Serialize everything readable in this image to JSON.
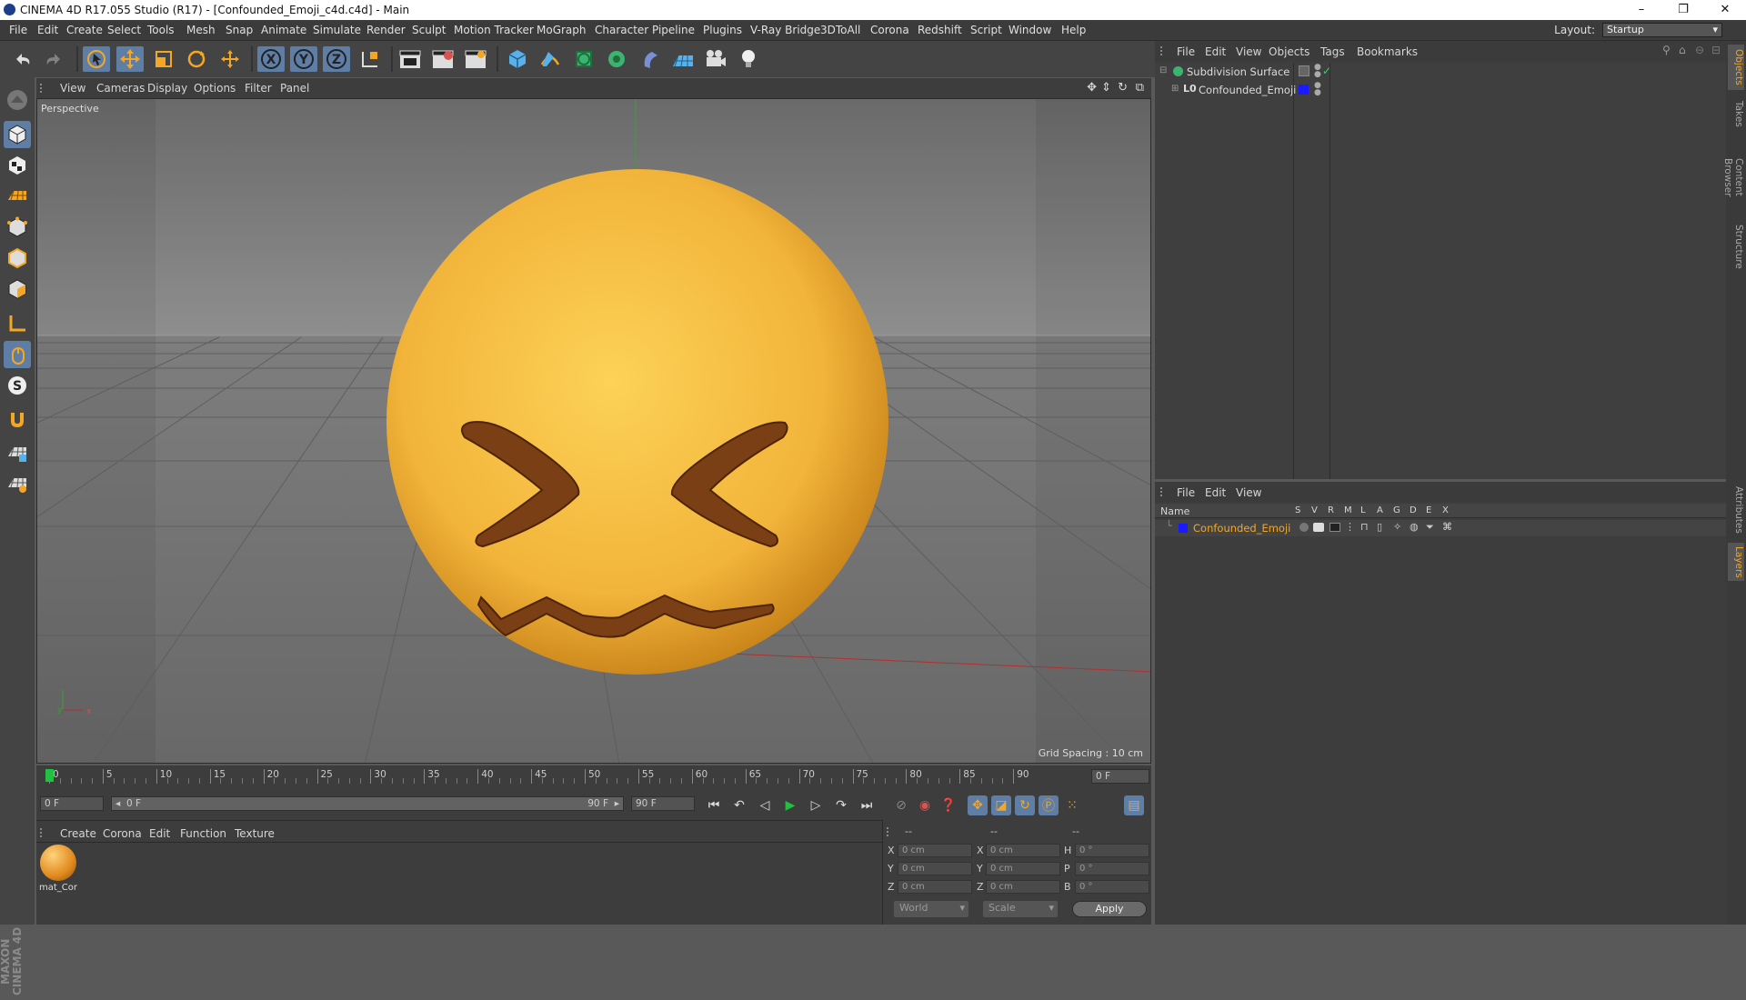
{
  "window": {
    "title": "CINEMA 4D R17.055 Studio (R17) - [Confounded_Emoji_c4d.c4d] - Main",
    "controls": [
      "–",
      "❐",
      "✕"
    ]
  },
  "menubar": {
    "items": [
      "File",
      "Edit",
      "Create",
      "Select",
      "Tools",
      "Mesh",
      "Snap",
      "Animate",
      "Simulate",
      "Render",
      "Sculpt",
      "Motion Tracker",
      "MoGraph",
      "Character",
      "Pipeline",
      "Plugins",
      "V-Ray Bridge",
      "3DToAll",
      "Corona",
      "Redshift",
      "Script",
      "Window",
      "Help"
    ],
    "layout_label": "Layout:",
    "layout_value": "Startup"
  },
  "viewport": {
    "menu": [
      "View",
      "Cameras",
      "Display",
      "Options",
      "Filter",
      "Panel"
    ],
    "label": "Perspective",
    "grid_spacing": "Grid Spacing : 10 cm",
    "axis_y": "y",
    "axis_x": "x"
  },
  "timeline": {
    "ticks": [
      "0",
      "5",
      "10",
      "15",
      "20",
      "25",
      "30",
      "35",
      "40",
      "45",
      "50",
      "55",
      "60",
      "65",
      "70",
      "75",
      "80",
      "85",
      "90"
    ],
    "current_frame": "0 F",
    "start_field": "0 F",
    "range_start": "0 F",
    "range_end": "90 F",
    "end_field": "90 F"
  },
  "materials": {
    "menu": [
      "Create",
      "Corona",
      "Edit",
      "Function",
      "Texture"
    ],
    "items": [
      {
        "name": "mat_Cor"
      }
    ]
  },
  "coordinates": {
    "headers": [
      "--",
      "--",
      "--"
    ],
    "rows": [
      {
        "a": "X",
        "av": "0 cm",
        "b": "X",
        "bv": "0 cm",
        "c": "H",
        "cv": "0 °"
      },
      {
        "a": "Y",
        "av": "0 cm",
        "b": "Y",
        "bv": "0 cm",
        "c": "P",
        "cv": "0 °"
      },
      {
        "a": "Z",
        "av": "0 cm",
        "b": "Z",
        "bv": "0 cm",
        "c": "B",
        "cv": "0 °"
      }
    ],
    "world": "World",
    "scale": "Scale",
    "apply": "Apply"
  },
  "object_manager": {
    "menu": [
      "File",
      "Edit",
      "View",
      "Objects",
      "Tags",
      "Bookmarks"
    ],
    "objects": [
      {
        "name": "Subdivision Surface",
        "icon": "subdivision-icon"
      },
      {
        "name": "Confounded_Emoji",
        "icon": "null-object-icon"
      }
    ]
  },
  "layer_manager": {
    "menu": [
      "File",
      "Edit",
      "View"
    ],
    "columns": [
      "Name",
      "S",
      "V",
      "R",
      "M",
      "L",
      "A",
      "G",
      "D",
      "E",
      "X"
    ],
    "layers": [
      {
        "name": "Confounded_Emoji",
        "color": "#1a1aff"
      }
    ]
  },
  "right_tabs": [
    "Objects",
    "Takes",
    "Content Browser",
    "Structure",
    "Attributes",
    "Layers"
  ],
  "maxon": "MAXON CINEMA 4D",
  "colors": {
    "accent": "#f5a623",
    "selected_tool": "#5f7ea6",
    "emoji_face": "#f2b43a",
    "emoji_feature": "#7a3f14"
  }
}
